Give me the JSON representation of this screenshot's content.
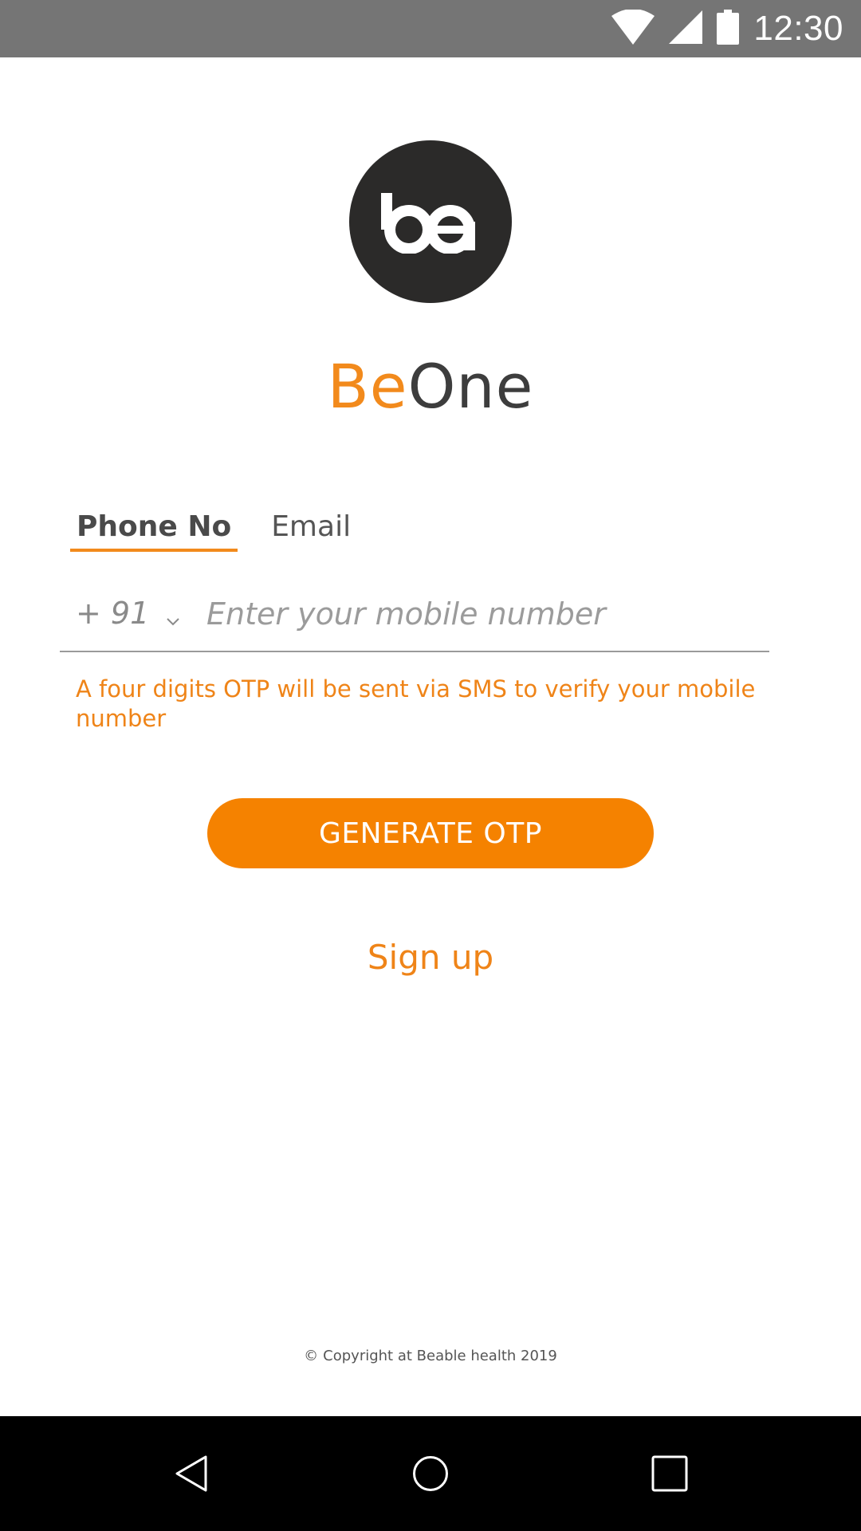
{
  "status_bar": {
    "time": "12:30",
    "icons": [
      "wifi-icon",
      "cellular-signal-icon",
      "battery-icon"
    ],
    "background": "#757575"
  },
  "logo": {
    "icon": "beone-logo-icon",
    "background": "#2b2a29"
  },
  "brand": {
    "part1": "Be",
    "part2": "One",
    "accent_color": "#f28a1c"
  },
  "tabs": [
    {
      "label": "Phone No",
      "active": true
    },
    {
      "label": "Email",
      "active": false
    }
  ],
  "phone_input": {
    "country_code": "+ 91",
    "dropdown_icon": "chevron-down-icon",
    "value": "",
    "placeholder": "Enter your mobile number"
  },
  "hint": "A four digits OTP will be sent via SMS to verify your mobile number",
  "generate_button": {
    "label": "GENERATE OTP",
    "color": "#f58200"
  },
  "signup_link": "Sign up",
  "footer": {
    "symbol": "©",
    "text": "Copyright at Beable health 2019"
  },
  "nav_bar": {
    "buttons": [
      "back-icon",
      "home-icon",
      "recents-icon"
    ]
  }
}
